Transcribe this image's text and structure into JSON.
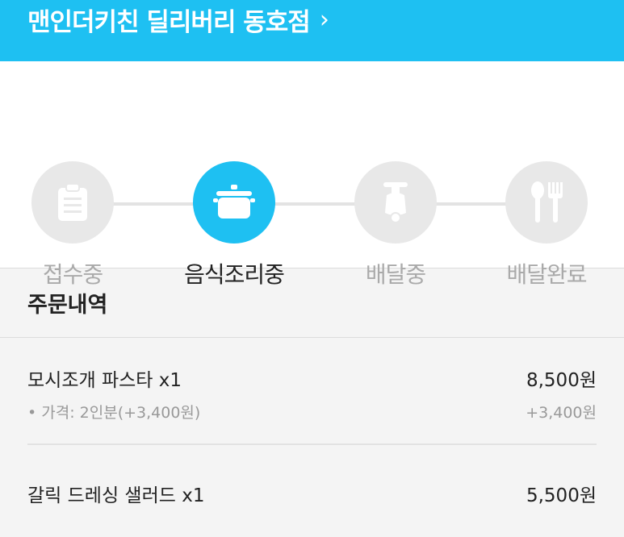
{
  "header": {
    "title": "맨인더키친 딜리버리 동호점",
    "chevron": "›"
  },
  "status": {
    "steps": [
      {
        "label": "접수중",
        "icon": "clipboard-icon",
        "active": false
      },
      {
        "label": "음식조리중",
        "icon": "cooking-pot-icon",
        "active": true
      },
      {
        "label": "배달중",
        "icon": "scooter-icon",
        "active": false
      },
      {
        "label": "배달완료",
        "icon": "spoon-fork-icon",
        "active": false
      }
    ]
  },
  "order": {
    "title": "주문내역",
    "items": [
      {
        "name": "모시조개 파스타  x1",
        "price": "8,500원",
        "option": "• 가격: 2인분(+3,400원)",
        "option_price": "+3,400원"
      },
      {
        "name": "갈릭 드레싱 샐러드  x1",
        "price": "5,500원"
      }
    ]
  },
  "colors": {
    "accent": "#1ec0f2",
    "inactive": "#e8e8e8",
    "inactive_icon": "#ffffff"
  }
}
